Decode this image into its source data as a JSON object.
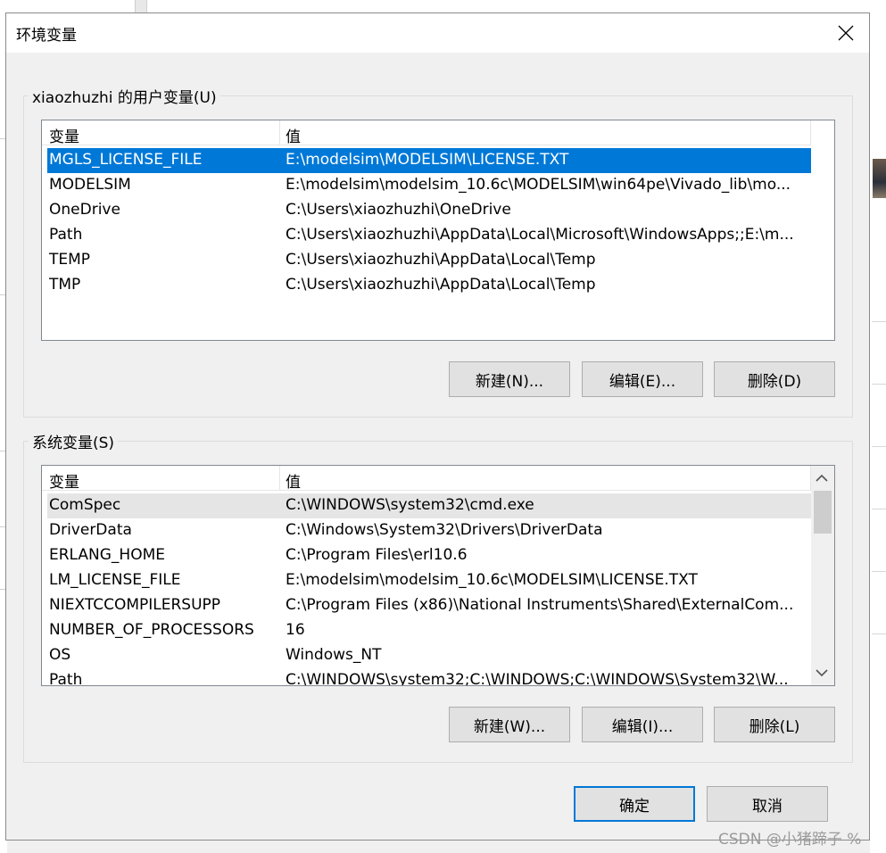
{
  "window": {
    "title": "环境变量"
  },
  "user_vars": {
    "group_label": "xiaozhuzhi 的用户变量(U)",
    "columns": [
      "变量",
      "值"
    ],
    "rows": [
      {
        "name": "MGLS_LICENSE_FILE",
        "value": "E:\\modelsim\\MODELSIM\\LICENSE.TXT"
      },
      {
        "name": "MODELSIM",
        "value": "E:\\modelsim\\modelsim_10.6c\\MODELSIM\\win64pe\\Vivado_lib\\mo..."
      },
      {
        "name": "OneDrive",
        "value": "C:\\Users\\xiaozhuzhi\\OneDrive"
      },
      {
        "name": "Path",
        "value": "C:\\Users\\xiaozhuzhi\\AppData\\Local\\Microsoft\\WindowsApps;;E:\\m..."
      },
      {
        "name": "TEMP",
        "value": "C:\\Users\\xiaozhuzhi\\AppData\\Local\\Temp"
      },
      {
        "name": "TMP",
        "value": "C:\\Users\\xiaozhuzhi\\AppData\\Local\\Temp"
      }
    ],
    "selected_row": "MGLS_LICENSE_FILE",
    "buttons": {
      "new": "新建(N)...",
      "edit": "编辑(E)...",
      "delete": "删除(D)"
    }
  },
  "system_vars": {
    "group_label": "系统变量(S)",
    "columns": [
      "变量",
      "值"
    ],
    "rows": [
      {
        "name": "ComSpec",
        "value": "C:\\WINDOWS\\system32\\cmd.exe"
      },
      {
        "name": "DriverData",
        "value": "C:\\Windows\\System32\\Drivers\\DriverData"
      },
      {
        "name": "ERLANG_HOME",
        "value": "C:\\Program Files\\erl10.6"
      },
      {
        "name": "LM_LICENSE_FILE",
        "value": "E:\\modelsim\\modelsim_10.6c\\MODELSIM\\LICENSE.TXT"
      },
      {
        "name": "NIEXTCCOMPILERSUPP",
        "value": "C:\\Program Files (x86)\\National Instruments\\Shared\\ExternalCom..."
      },
      {
        "name": "NUMBER_OF_PROCESSORS",
        "value": "16"
      },
      {
        "name": "OS",
        "value": "Windows_NT"
      },
      {
        "name": "Path",
        "value": "C:\\WINDOWS\\system32;C:\\WINDOWS;C:\\WINDOWS\\System32\\W..."
      }
    ],
    "hovered_row": "ComSpec",
    "buttons": {
      "new": "新建(W)...",
      "edit": "编辑(I)...",
      "delete": "删除(L)"
    }
  },
  "footer": {
    "ok": "确定",
    "cancel": "取消"
  },
  "watermark": "CSDN @小猪蹄子 %",
  "colors": {
    "selection": "#0078d7",
    "hover_row": "#e5e5e5",
    "button_face": "#e1e1e1",
    "default_border": "#0078d7"
  },
  "icons": {
    "close": "close-icon",
    "scroll_up": "chevron-up-icon",
    "scroll_down": "chevron-down-icon"
  }
}
